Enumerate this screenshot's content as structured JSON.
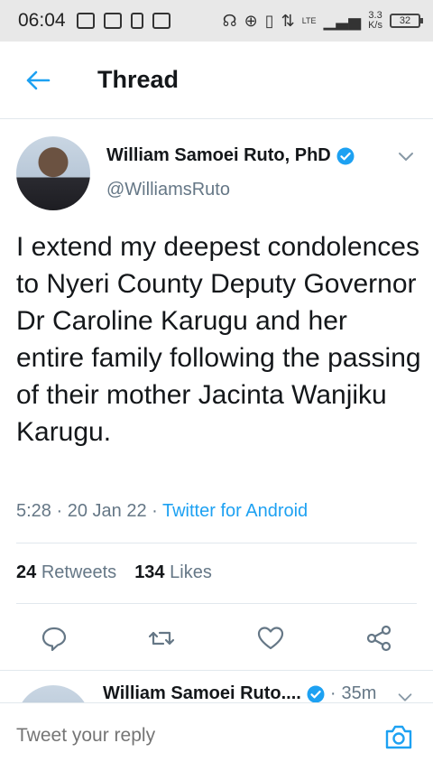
{
  "status_bar": {
    "time": "06:04",
    "network": "LTE",
    "speed_value": "3.3",
    "speed_unit": "K/s",
    "battery": "32"
  },
  "header": {
    "title": "Thread"
  },
  "tweet": {
    "author_name": "William Samoei Ruto, PhD",
    "handle": "@WilliamsRuto",
    "text": "I extend my deepest condolences to Nyeri County Deputy Governor Dr Caroline Karugu and her entire family following the passing of their mother Jacinta Wanjiku Karugu.",
    "time": "5:28",
    "date": "20 Jan 22",
    "source": "Twitter for Android",
    "retweets_count": "24",
    "retweets_label": "Retweets",
    "likes_count": "134",
    "likes_label": "Likes"
  },
  "next_tweet": {
    "author_name": "William Samoei Ruto....",
    "time": "35m"
  },
  "reply": {
    "placeholder": "Tweet your reply"
  },
  "colors": {
    "accent": "#1da1f2",
    "muted": "#657786",
    "text": "#14171a"
  },
  "icons": [
    "back-arrow-icon",
    "verified-badge-icon",
    "chevron-down-icon",
    "reply-icon",
    "retweet-icon",
    "like-icon",
    "share-icon",
    "camera-icon"
  ]
}
